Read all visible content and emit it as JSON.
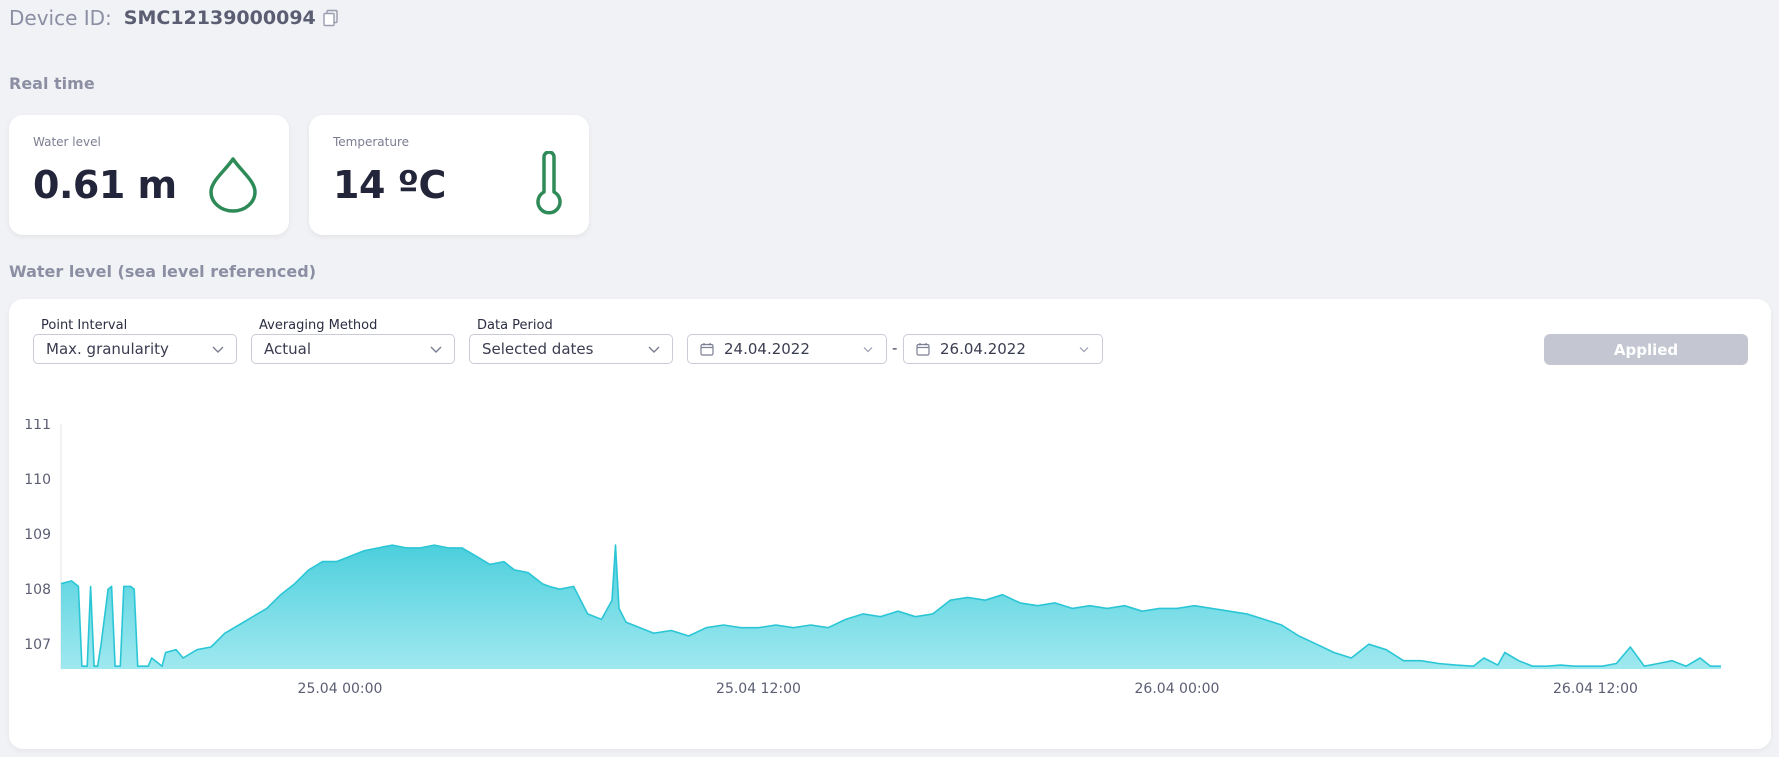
{
  "device": {
    "label": "Device ID:",
    "id": "SMC12139000094"
  },
  "realtime": {
    "title": "Real time",
    "cards": [
      {
        "label": "Water level",
        "value": "0.61 m",
        "icon": "water-drop-icon"
      },
      {
        "label": "Temperature",
        "value": "14 ºC",
        "icon": "thermometer-icon"
      }
    ]
  },
  "history": {
    "title": "Water level (sea level referenced)",
    "filters": {
      "point_interval": {
        "label": "Point Interval",
        "value": "Max. granularity"
      },
      "averaging_method": {
        "label": "Averaging Method",
        "value": "Actual"
      },
      "data_period": {
        "label": "Data Period",
        "value": "Selected dates"
      },
      "date_from": "24.04.2022",
      "date_separator": "-",
      "date_to": "26.04.2022",
      "apply_label": "Applied"
    }
  },
  "colors": {
    "accent": "#2e8b57",
    "series_line": "#2bc6d6",
    "series_fill": "#7fe1ea"
  },
  "chart_data": {
    "type": "area",
    "xlabel": "",
    "ylabel": "",
    "x_tick_labels": [
      "25.04 00:00",
      "25.04 12:00",
      "26.04 00:00",
      "26.04 12:00"
    ],
    "x_tick_hours": [
      24,
      36,
      48,
      60
    ],
    "y_ticks": [
      107,
      108,
      109,
      110,
      111
    ],
    "ylim": [
      106.55,
      111
    ],
    "xlim_hours": [
      16,
      63.6
    ],
    "grid": false,
    "series": [
      {
        "x_hours": [
          16,
          16.3,
          16.5,
          16.6,
          16.75,
          16.85,
          16.95,
          17.05,
          17.15,
          17.35,
          17.45,
          17.55,
          17.6,
          17.7,
          17.8,
          18.0,
          18.1,
          18.2,
          18.5,
          18.6,
          18.9,
          19.0,
          19.3,
          19.5,
          19.9,
          20.3,
          20.7,
          21.1,
          21.5,
          21.9,
          22.3,
          22.7,
          23.1,
          23.5,
          23.9,
          24.3,
          24.7,
          25.1,
          25.5,
          25.9,
          26.3,
          26.7,
          27.1,
          27.5,
          27.9,
          28.3,
          28.7,
          29.0,
          29.4,
          29.6,
          29.8,
          30.0,
          30.3,
          30.7,
          31.1,
          31.5,
          31.8,
          31.9,
          32.0,
          32.2,
          32.6,
          33.0,
          33.5,
          34,
          34.5,
          35,
          35.5,
          36,
          36.5,
          37,
          37.5,
          38,
          38.5,
          39,
          39.5,
          40,
          40.5,
          41,
          41.5,
          42,
          42.5,
          43,
          43.5,
          44,
          44.5,
          45,
          45.5,
          46,
          46.5,
          47,
          47.5,
          48,
          48.5,
          49,
          49.5,
          50,
          50.5,
          51,
          51.5,
          52,
          52.5,
          53,
          53.5,
          54,
          54.5,
          55,
          55.5,
          56,
          56.5,
          56.8,
          57.2,
          57.4,
          57.8,
          58.2,
          58.6,
          59.0,
          59.4,
          59.8,
          60.2,
          60.6,
          61.0,
          61.4,
          61.8,
          62.2,
          62.6,
          63.0,
          63.3,
          63.6
        ],
        "values": [
          108.1,
          108.15,
          108.05,
          106.6,
          106.6,
          108.05,
          106.6,
          106.6,
          107.0,
          108.0,
          108.05,
          106.6,
          106.6,
          106.6,
          108.05,
          108.05,
          108.0,
          106.6,
          106.6,
          106.75,
          106.6,
          106.85,
          106.9,
          106.75,
          106.9,
          106.95,
          107.2,
          107.35,
          107.5,
          107.65,
          107.9,
          108.1,
          108.35,
          108.5,
          108.5,
          108.6,
          108.7,
          108.75,
          108.8,
          108.75,
          108.75,
          108.8,
          108.75,
          108.75,
          108.6,
          108.45,
          108.5,
          108.35,
          108.3,
          108.2,
          108.1,
          108.05,
          108.0,
          108.05,
          107.55,
          107.45,
          107.8,
          108.8,
          107.65,
          107.4,
          107.3,
          107.2,
          107.25,
          107.15,
          107.3,
          107.35,
          107.3,
          107.3,
          107.35,
          107.3,
          107.35,
          107.3,
          107.45,
          107.55,
          107.5,
          107.6,
          107.5,
          107.55,
          107.8,
          107.85,
          107.8,
          107.9,
          107.75,
          107.7,
          107.75,
          107.65,
          107.7,
          107.65,
          107.7,
          107.6,
          107.65,
          107.65,
          107.7,
          107.65,
          107.6,
          107.55,
          107.45,
          107.35,
          107.15,
          107.0,
          106.85,
          106.75,
          107.0,
          106.9,
          106.7,
          106.7,
          106.65,
          106.62,
          106.6,
          106.75,
          106.62,
          106.85,
          106.7,
          106.6,
          106.6,
          106.62,
          106.6,
          106.6,
          106.6,
          106.65,
          106.95,
          106.6,
          106.65,
          106.7,
          106.6,
          106.75,
          106.6,
          106.6
        ]
      }
    ]
  }
}
